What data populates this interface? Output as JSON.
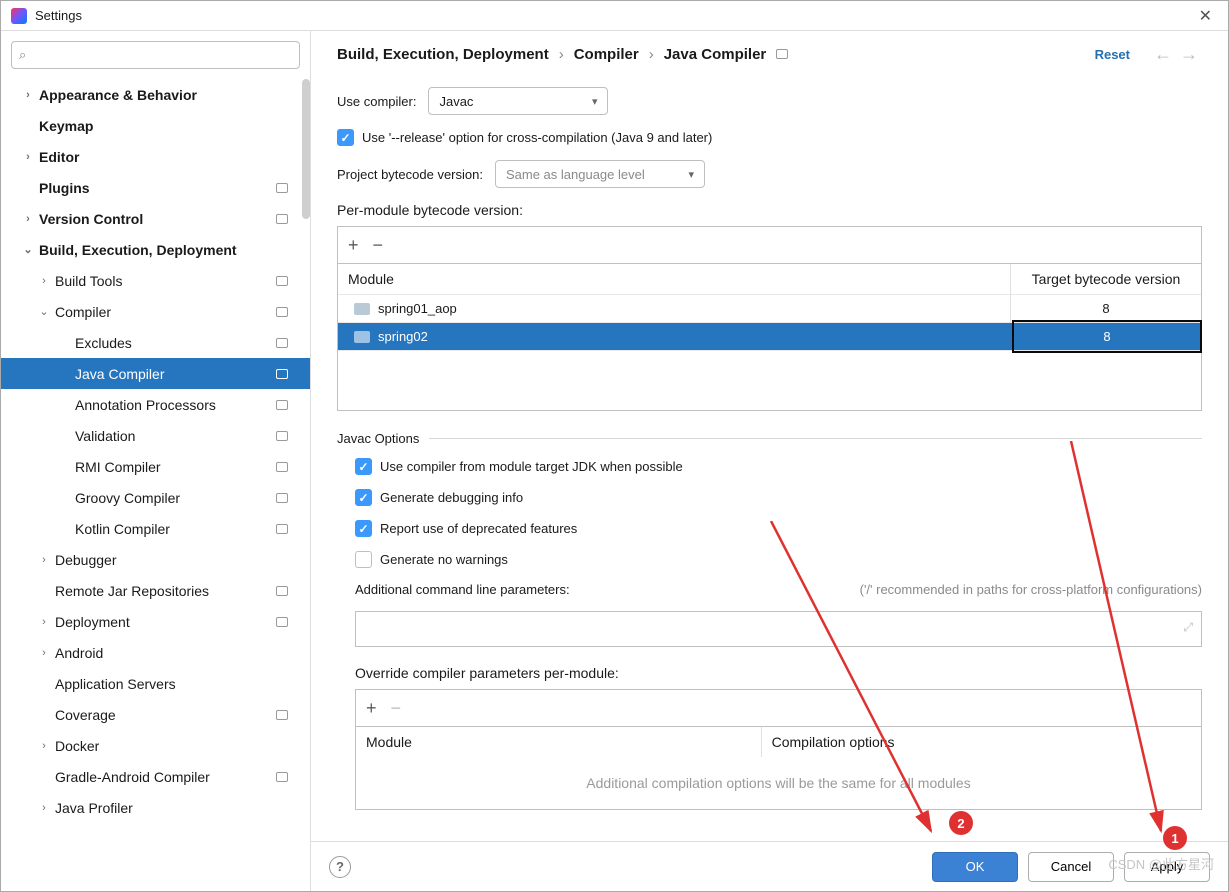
{
  "window": {
    "title": "Settings"
  },
  "search": {
    "placeholder": ""
  },
  "sidebar": {
    "items": [
      {
        "label": "Appearance & Behavior",
        "bold": true,
        "chev": "›",
        "depth": 0,
        "badge": false
      },
      {
        "label": "Keymap",
        "bold": true,
        "chev": "",
        "depth": 0,
        "badge": false
      },
      {
        "label": "Editor",
        "bold": true,
        "chev": "›",
        "depth": 0,
        "badge": false
      },
      {
        "label": "Plugins",
        "bold": true,
        "chev": "",
        "depth": 0,
        "badge": true
      },
      {
        "label": "Version Control",
        "bold": true,
        "chev": "›",
        "depth": 0,
        "badge": true
      },
      {
        "label": "Build, Execution, Deployment",
        "bold": true,
        "chev": "⌄",
        "depth": 0,
        "badge": false
      },
      {
        "label": "Build Tools",
        "bold": false,
        "chev": "›",
        "depth": 1,
        "badge": true
      },
      {
        "label": "Compiler",
        "bold": false,
        "chev": "⌄",
        "depth": 1,
        "badge": true
      },
      {
        "label": "Excludes",
        "bold": false,
        "chev": "",
        "depth": 2,
        "badge": true
      },
      {
        "label": "Java Compiler",
        "bold": false,
        "chev": "",
        "depth": 2,
        "badge": true,
        "selected": true
      },
      {
        "label": "Annotation Processors",
        "bold": false,
        "chev": "",
        "depth": 2,
        "badge": true
      },
      {
        "label": "Validation",
        "bold": false,
        "chev": "",
        "depth": 2,
        "badge": true
      },
      {
        "label": "RMI Compiler",
        "bold": false,
        "chev": "",
        "depth": 2,
        "badge": true
      },
      {
        "label": "Groovy Compiler",
        "bold": false,
        "chev": "",
        "depth": 2,
        "badge": true
      },
      {
        "label": "Kotlin Compiler",
        "bold": false,
        "chev": "",
        "depth": 2,
        "badge": true
      },
      {
        "label": "Debugger",
        "bold": false,
        "chev": "›",
        "depth": 1,
        "badge": false
      },
      {
        "label": "Remote Jar Repositories",
        "bold": false,
        "chev": "",
        "depth": 1,
        "badge": true
      },
      {
        "label": "Deployment",
        "bold": false,
        "chev": "›",
        "depth": 1,
        "badge": true
      },
      {
        "label": "Android",
        "bold": false,
        "chev": "›",
        "depth": 1,
        "badge": false
      },
      {
        "label": "Application Servers",
        "bold": false,
        "chev": "",
        "depth": 1,
        "badge": false
      },
      {
        "label": "Coverage",
        "bold": false,
        "chev": "",
        "depth": 1,
        "badge": true
      },
      {
        "label": "Docker",
        "bold": false,
        "chev": "›",
        "depth": 1,
        "badge": false
      },
      {
        "label": "Gradle-Android Compiler",
        "bold": false,
        "chev": "",
        "depth": 1,
        "badge": true
      },
      {
        "label": "Java Profiler",
        "bold": false,
        "chev": "›",
        "depth": 1,
        "badge": false
      }
    ]
  },
  "breadcrumb": {
    "a": "Build, Execution, Deployment",
    "b": "Compiler",
    "c": "Java Compiler"
  },
  "header": {
    "reset": "Reset"
  },
  "form": {
    "use_compiler_label": "Use compiler:",
    "use_compiler_value": "Javac",
    "release_option": "Use '--release' option for cross-compilation (Java 9 and later)",
    "project_bytecode_label": "Project bytecode version:",
    "project_bytecode_value": "Same as language level",
    "per_module_label": "Per-module bytecode version:",
    "module_header": "Module",
    "target_header": "Target bytecode version",
    "rows": [
      {
        "module": "spring01_aop",
        "target": "8",
        "selected": false
      },
      {
        "module": "spring02",
        "target": "8",
        "selected": true
      }
    ],
    "javac_group": "Javac Options",
    "opt_use_module_jdk": "Use compiler from module target JDK when possible",
    "opt_debug": "Generate debugging info",
    "opt_deprecated": "Report use of deprecated features",
    "opt_no_warnings": "Generate no warnings",
    "additional_params_label": "Additional command line parameters:",
    "additional_params_hint": "('/' recommended in paths for cross-platform configurations)",
    "override_label": "Override compiler parameters per-module:",
    "override_col1": "Module",
    "override_col2": "Compilation options",
    "override_empty": "Additional compilation options will be the same for all modules"
  },
  "footer": {
    "ok": "OK",
    "cancel": "Cancel",
    "apply": "Apply"
  },
  "annotations": {
    "one": "1",
    "two": "2"
  },
  "watermark": "CSDN @此方星河"
}
